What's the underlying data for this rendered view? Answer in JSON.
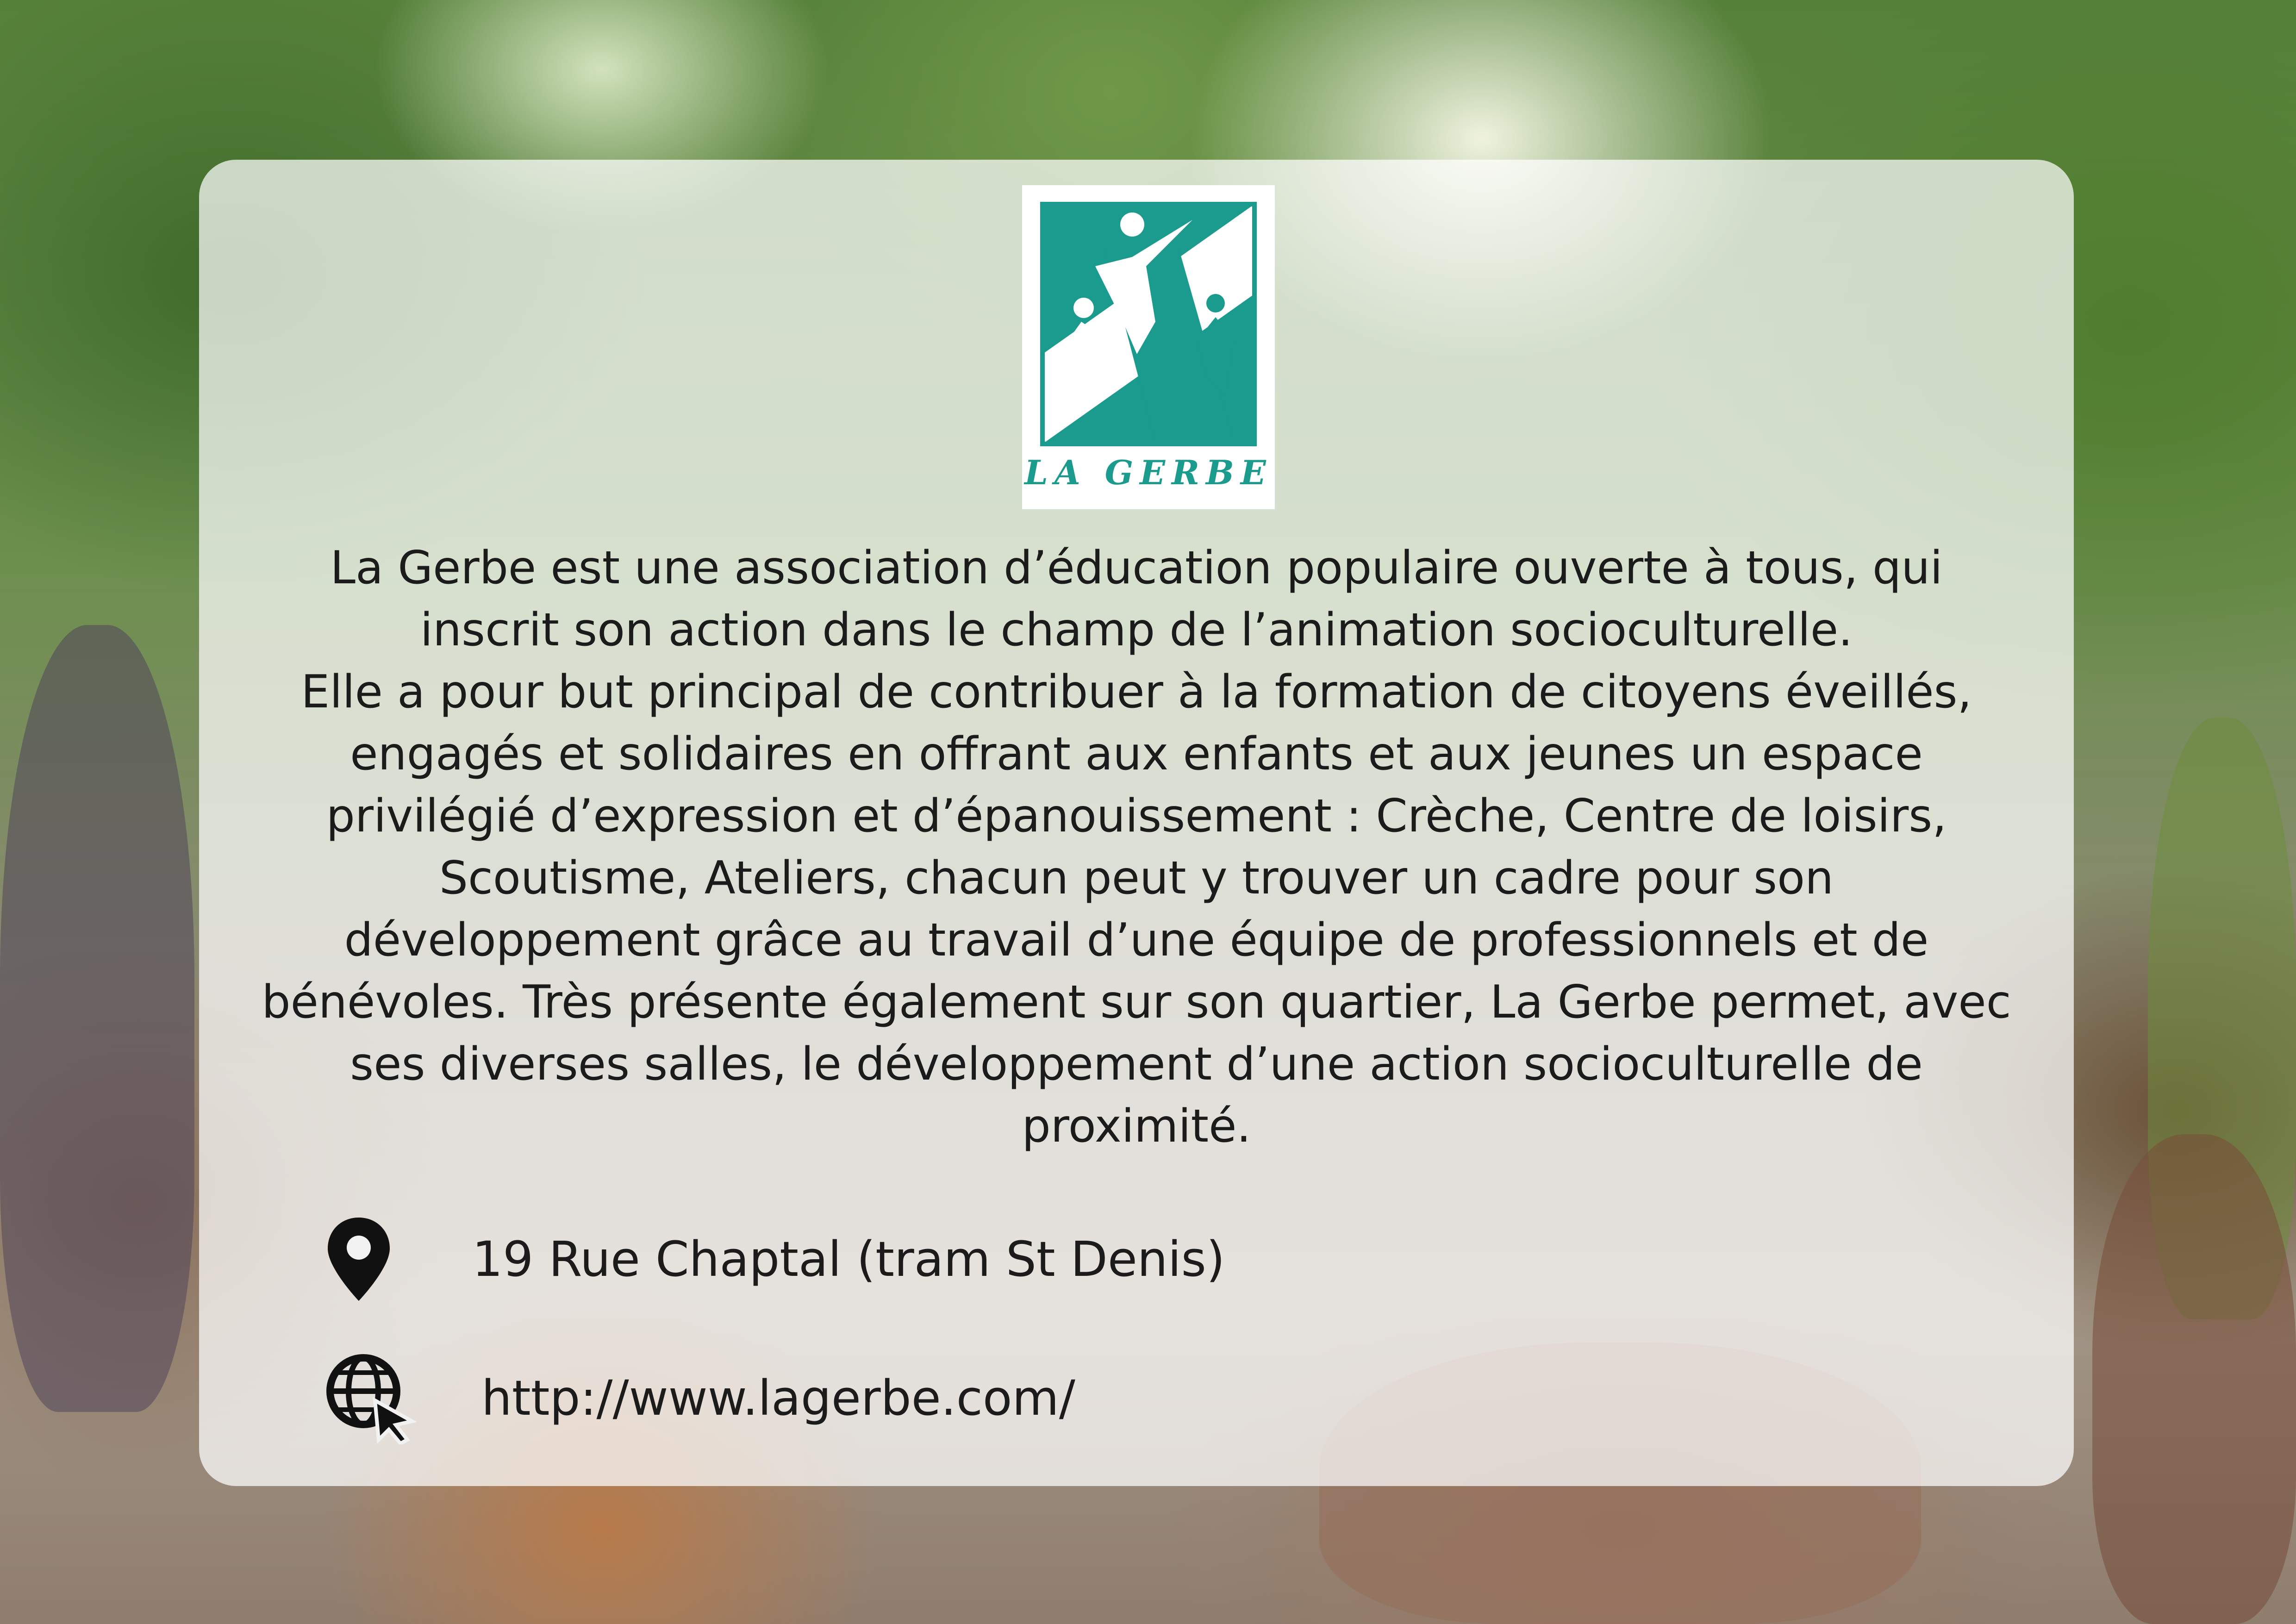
{
  "logo": {
    "name": "LA GERBE",
    "colors": {
      "teal": "#1b9a8e",
      "background": "#ffffff"
    }
  },
  "description": {
    "paragraph1": "La Gerbe est une association d’éducation populaire ouverte à tous, qui inscrit son action dans le champ de l’animation socioculturelle.",
    "paragraph2": "Elle a pour but principal de contribuer à la formation de citoyens éveillés, engagés et solidaires en offrant aux enfants et aux jeunes un espace privilégié d’expression et d’épanouissement : Crèche, Centre de loisirs, Scoutisme, Ateliers, chacun peut y trouver un cadre pour son développement grâce au travail d’une équipe de professionnels et de bénévoles. Très présente également sur son quartier, La Gerbe permet, avec ses diverses salles, le développement d’une action socioculturelle de proximité."
  },
  "contact": {
    "address": {
      "icon": "map-pin-icon",
      "text": "19 Rue Chaptal (tram St Denis)"
    },
    "website": {
      "icon": "globe-cursor-icon",
      "text": "http://www.lagerbe.com/"
    }
  },
  "colors": {
    "text": "#1b1b1b",
    "panel": "rgba(255,255,255,0.72)"
  }
}
